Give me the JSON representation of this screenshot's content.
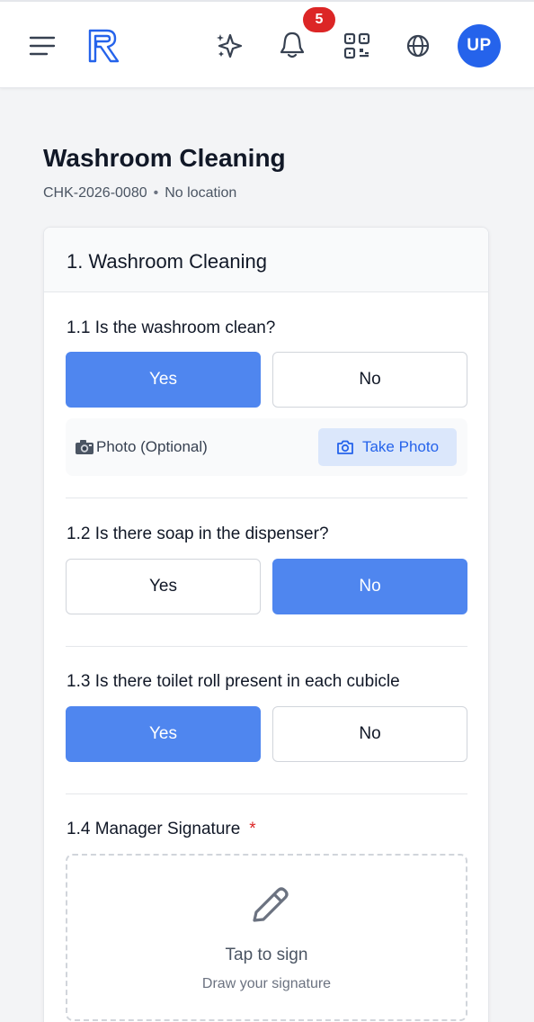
{
  "header": {
    "notification_count": "5",
    "avatar_initials": "UP",
    "icons": [
      "menu-icon",
      "app-logo-icon",
      "sparkle-icon",
      "bell-icon",
      "qr-code-icon",
      "globe-icon"
    ]
  },
  "page": {
    "title": "Washroom Cleaning",
    "code": "CHK-2026-0080",
    "separator": "•",
    "location": "No location"
  },
  "section": {
    "title": "1. Washroom Cleaning",
    "questions": [
      {
        "label": "1.1 Is the washroom clean?",
        "yes": "Yes",
        "no": "No",
        "selected": "Yes"
      },
      {
        "label": "1.2 Is there soap in the dispenser?",
        "yes": "Yes",
        "no": "No",
        "selected": "No"
      },
      {
        "label": "1.3 Is there toilet roll present in each cubicle",
        "yes": "Yes",
        "no": "No",
        "selected": "Yes"
      }
    ],
    "photo": {
      "emoji": "📷",
      "label": "Photo (Optional)",
      "button": "Take Photo"
    },
    "signature": {
      "label": "1.4 Manager Signature",
      "required_mark": "*",
      "title": "Tap to sign",
      "hint": "Draw your signature"
    }
  },
  "colors": {
    "accent": "#4f86ef",
    "link": "#2563eb",
    "badge": "#dc2626",
    "avatar": "#2563eb"
  }
}
